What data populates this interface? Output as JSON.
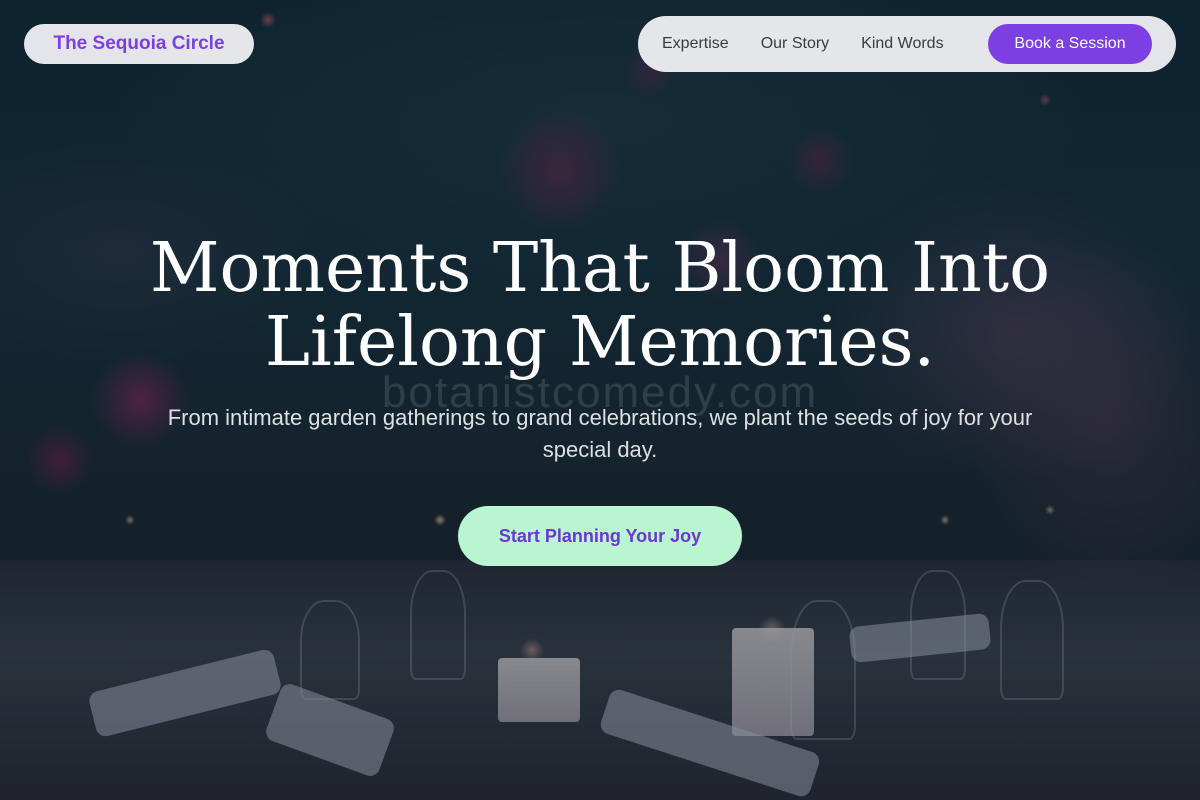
{
  "brand": {
    "name": "The Sequoia Circle",
    "accent_color": "#7b3fe4"
  },
  "nav": {
    "links": [
      "Expertise",
      "Our Story",
      "Kind Words"
    ],
    "cta_label": "Book a Session"
  },
  "hero": {
    "headline_line1": "Moments That Bloom Into",
    "headline_line2": "Lifelong Memories.",
    "watermark": "botanistcomedy.com",
    "subheadline": "From intimate garden gatherings to grand celebrations, we plant the seeds of joy for your special day.",
    "cta_label": "Start Planning Your Joy",
    "cta_color": "#b9f5d0"
  }
}
